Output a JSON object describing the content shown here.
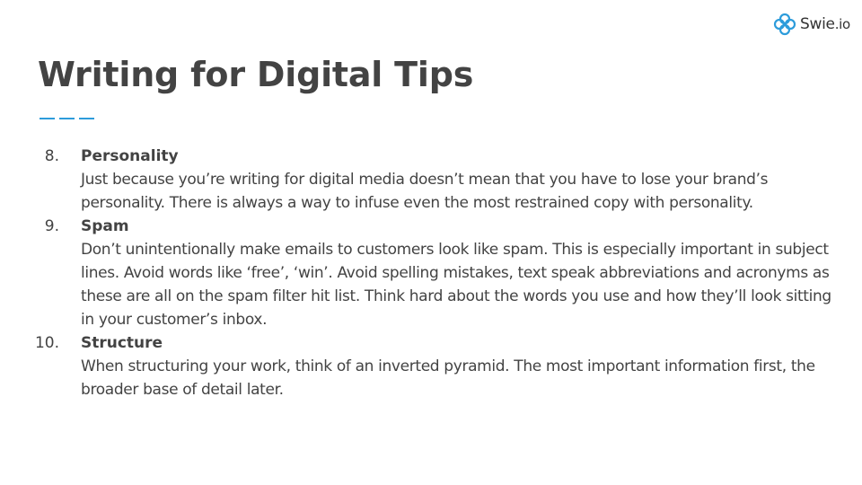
{
  "brand": {
    "name": "Swie",
    "tld": ".io",
    "icon": "knot-logo-icon",
    "color": "#2d9cdb"
  },
  "slide": {
    "title": "Writing for Digital Tips",
    "accent_color": "#2d9cdb",
    "text_color": "#434343"
  },
  "tips": [
    {
      "number": "8.",
      "heading": "Personality",
      "body": "Just because you’re writing for digital media doesn’t mean that you have to lose your brand’s personality. There is always a way to infuse even the most restrained copy with personality."
    },
    {
      "number": "9.",
      "heading": "Spam",
      "body": "Don’t unintentionally make emails to customers look like spam. This is especially important in subject lines. Avoid words like ‘free’, ‘win’. Avoid spelling mistakes, text speak abbreviations and acronyms as these are all on the spam filter hit list. Think hard about the words you use and how they’ll look sitting in your customer’s inbox."
    },
    {
      "number": "10.",
      "heading": "Structure",
      "body": "When structuring your work, think of an inverted pyramid. The most important information first, the broader base of detail later."
    }
  ]
}
